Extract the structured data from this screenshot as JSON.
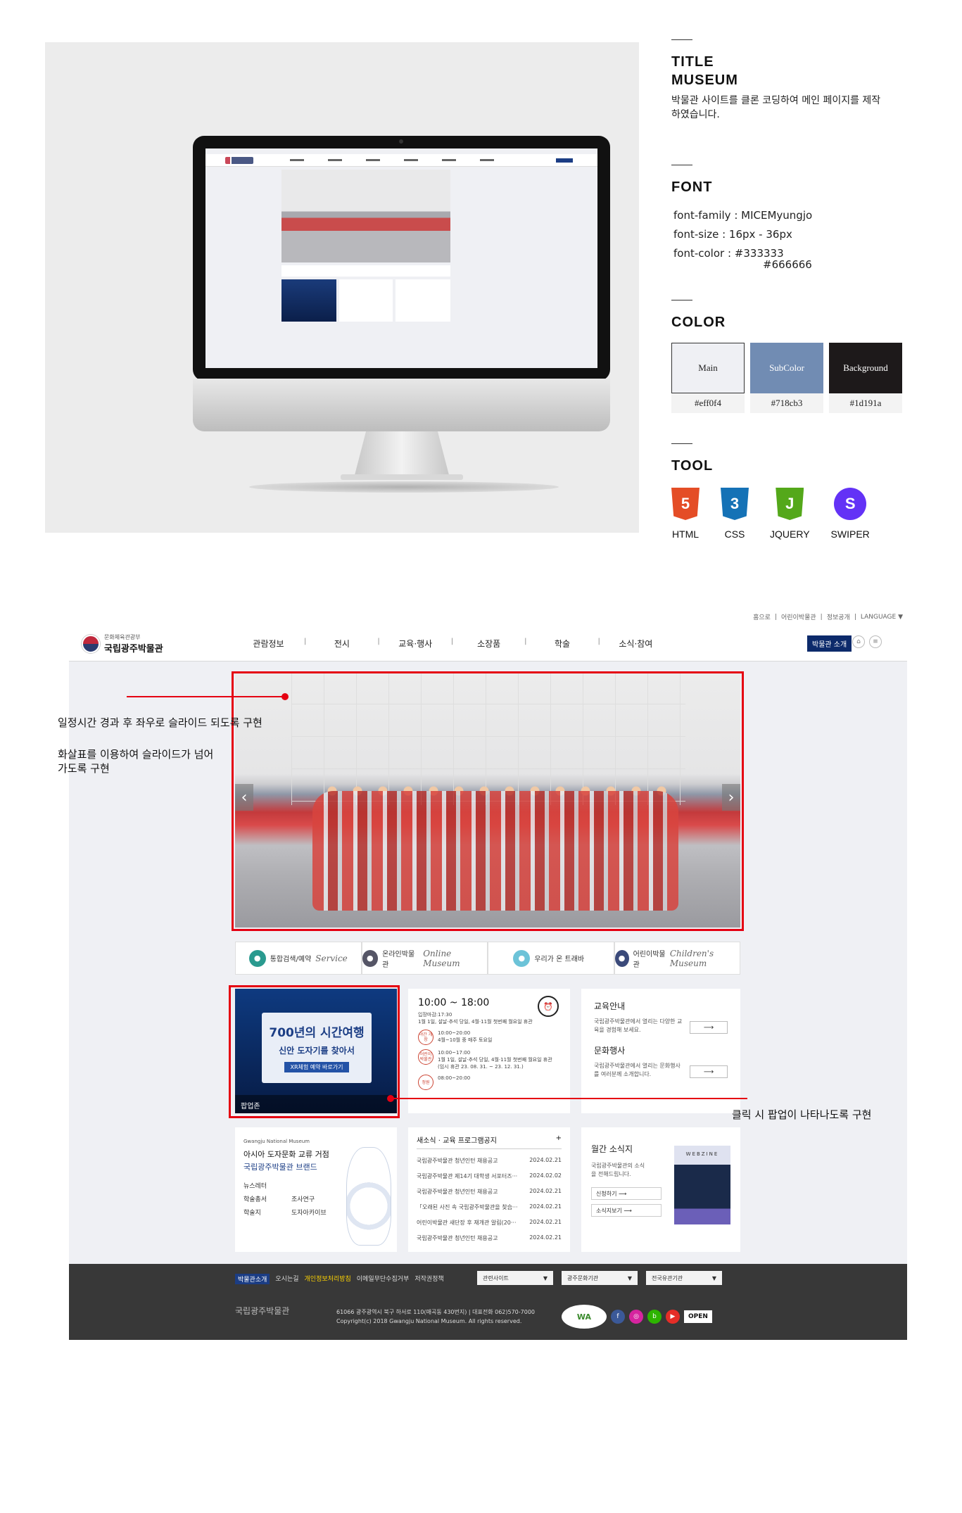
{
  "panel": {
    "title_label": "TITLE",
    "title_value": "MUSEUM",
    "description": "박물관 사이트를 클론 코딩하여 메인 페이지를 제작하였습니다.",
    "font_label": "FONT",
    "font_family": "font-family :  MICEMyungjo",
    "font_size": "font-size : 16px - 36px",
    "font_color": "font-color : #333333",
    "font_color_2": "#666666",
    "color_label": "COLOR",
    "swatches": [
      {
        "name": "Main",
        "code": "#eff0f4",
        "color": "#eff0f4",
        "text": "#222222"
      },
      {
        "name": "SubColor",
        "code": "#718cb3",
        "color": "#718cb3",
        "text": "#ffffff"
      },
      {
        "name": "Background",
        "code": "#1d191a",
        "color": "#1d191a",
        "text": "#ffffff"
      }
    ],
    "tool_label": "TOOL",
    "tools": [
      {
        "name": "HTML",
        "glyph": "5",
        "color": "#e44d26",
        "icon": "html5-icon"
      },
      {
        "name": "CSS",
        "glyph": "3",
        "color": "#1572b6",
        "icon": "css3-icon"
      },
      {
        "name": "JQUERY",
        "glyph": "J",
        "color": "#54a81a",
        "icon": "jquery-icon"
      },
      {
        "name": "SWIPER",
        "glyph": "S",
        "color": "#6332f6",
        "icon": "swiper-icon"
      }
    ]
  },
  "site": {
    "util": [
      "홈으로",
      "|",
      "어린이박물관",
      "|",
      "정보공개",
      "|",
      "LANGUAGE ▼"
    ],
    "logo_small": "문화체육관광부",
    "logo_big": "국립광주박물관",
    "nav": [
      "관람정보",
      "전시",
      "교육·행사",
      "소장품",
      "학술",
      "소식·참여"
    ],
    "intro_button": "박물관 소개",
    "shortcuts": [
      {
        "icon": "search-icon",
        "label": "통합검색/예약",
        "script": "Service",
        "color": "#2a9a8f"
      },
      {
        "icon": "user-icon",
        "label": "온라인박물관",
        "script": "Online Museum",
        "color": "#555566"
      },
      {
        "icon": "shell-icon",
        "label": "우리가 온 트래바",
        "script": "",
        "color": "#6cc3d8"
      },
      {
        "icon": "house-icon",
        "label": "어린이박물관",
        "script": "Children's Museum",
        "color": "#3b4a7a"
      }
    ],
    "popup": {
      "line1": "700년의 시간여행",
      "line2": "신안 도자기를 찾아서",
      "line3": "XR체험 예약 바로가기",
      "zone": "팝업존"
    },
    "hours": {
      "time": "10:00 ~ 18:00",
      "line1": "입장마감:17:30",
      "line2": "1월 1일, 설날·추석 당일, 4월·11월 첫번째 월요일 휴관",
      "rows": [
        {
          "tag": "야간 개장",
          "lines": [
            "10:00~20:00",
            "4월~10월 중 매주 토요일"
          ]
        },
        {
          "tag": "어린이 박물관",
          "lines": [
            "10:00~17:00",
            "1월 1일, 설날·추석 당일, 4월·11월 첫번째 월요일 휴관",
            "(임시 휴관 23. 08. 31. ~ 23. 12. 31.)"
          ]
        },
        {
          "tag": "정원",
          "lines": [
            "08:00~20:00"
          ]
        }
      ]
    },
    "guide": [
      {
        "title": "교육안내",
        "text": "국립광주박물관에서 열리는 다양한 교육을 경험해 보세요.",
        "more": "⟶"
      },
      {
        "title": "문화행사",
        "text": "국립광주박물관에서 열리는 문화행사를 여러분께 소개합니다.",
        "more": "⟶"
      }
    ],
    "brand": {
      "en": "Gwangju National Museum",
      "t1": "아시아 도자문화 교류 거점",
      "t2": "국립광주박물관 브랜드",
      "links": [
        "뉴스레터",
        "",
        "학술총서",
        "조사연구",
        "학술지",
        "도자아카이브"
      ]
    },
    "notice": {
      "title": "새소식 · 교육 프로그램공지",
      "plus": "+",
      "items": [
        {
          "title": "국립광주박물관 청년인턴 채용공고",
          "date": "2024.02.21"
        },
        {
          "title": "국립광주박물관 제14기 대학생 서포터즈···",
          "date": "2024.02.02"
        },
        {
          "title": "국립광주박물관 청년인턴 채용공고",
          "date": "2024.02.21"
        },
        {
          "title": "「오래된 사진 속 국립광주박물관을 찾습···",
          "date": "2024.02.21"
        },
        {
          "title": "어린이박물관 새단장 후 재개관 알림(20···",
          "date": "2024.02.21"
        },
        {
          "title": "국립광주박물관 청년인턴 채용공고",
          "date": "2024.02.21"
        }
      ]
    },
    "monthly": {
      "title": "월간 소식지",
      "text": "국립광주박물관의 소식을 전해드립니다.",
      "btn1": "신청하기",
      "btn2": "소식지보기",
      "webzine": "WEBZINE"
    },
    "footer": {
      "links": [
        "박물관소개",
        "오시는길",
        "개인정보처리방침",
        "이메일무단수집거부",
        "저작권정책"
      ],
      "selects": [
        "관련사이트",
        "광주문화기관",
        "전국유관기관"
      ],
      "logo": "국립광주박물관",
      "addr1": "61066 광주광역시 북구 하서로 110(매곡동 430번지) | 대표전화 062)570-7000",
      "addr2": "Copyright(c) 2018 Gwangju National Museum. All rights reserved.",
      "wa": "WA",
      "open": "OPEN"
    }
  },
  "annotations": {
    "slide_note_1": "일정시간 경과 후 좌우로 슬라이드 되도록 구현",
    "slide_note_2": "화살표를 이용하여 슬라이드가 넘어가도록 구현",
    "popup_note": "클릭 시 팝업이 나타나도록 구현"
  }
}
